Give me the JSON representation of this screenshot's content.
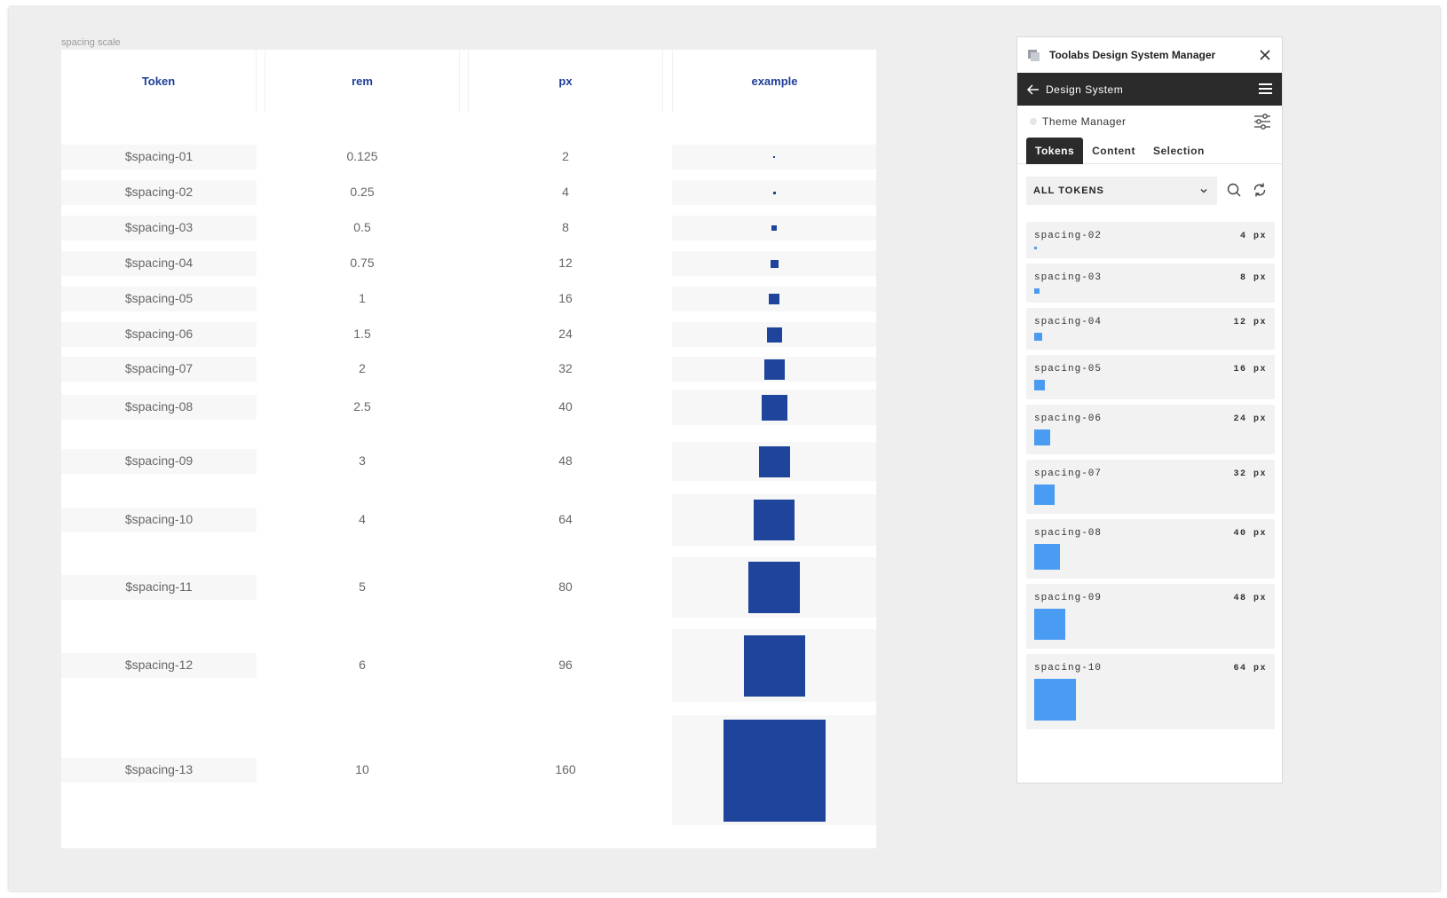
{
  "frame": {
    "label": "spacing scale"
  },
  "table": {
    "headers": [
      "Token",
      "rem",
      "px",
      "example"
    ],
    "rows": [
      {
        "token": "$spacing-01",
        "rem": "0.125",
        "px": "2"
      },
      {
        "token": "$spacing-02",
        "rem": "0.25",
        "px": "4"
      },
      {
        "token": "$spacing-03",
        "rem": "0.5",
        "px": "8"
      },
      {
        "token": "$spacing-04",
        "rem": "0.75",
        "px": "12"
      },
      {
        "token": "$spacing-05",
        "rem": "1",
        "px": "16"
      },
      {
        "token": "$spacing-06",
        "rem": "1.5",
        "px": "24"
      },
      {
        "token": "$spacing-07",
        "rem": "2",
        "px": "32"
      },
      {
        "token": "$spacing-08",
        "rem": "2.5",
        "px": "40"
      },
      {
        "token": "$spacing-09",
        "rem": "3",
        "px": "48"
      },
      {
        "token": "$spacing-10",
        "rem": "4",
        "px": "64"
      },
      {
        "token": "$spacing-11",
        "rem": "5",
        "px": "80"
      },
      {
        "token": "$spacing-12",
        "rem": "6",
        "px": "96"
      },
      {
        "token": "$spacing-13",
        "rem": "10",
        "px": "160"
      }
    ],
    "example_color": "#1e449c"
  },
  "plugin": {
    "title": "Toolabs Design System Manager",
    "nav_title": "Design System",
    "theme_label": "Theme Manager",
    "tabs": [
      "Tokens",
      "Content",
      "Selection"
    ],
    "active_tab": "Tokens",
    "filter_value": "ALL TOKENS",
    "token_color": "#4a9cf2",
    "tokens": [
      {
        "name": "spacing-02",
        "value": "4 px"
      },
      {
        "name": "spacing-03",
        "value": "8 px"
      },
      {
        "name": "spacing-04",
        "value": "12 px"
      },
      {
        "name": "spacing-05",
        "value": "16 px"
      },
      {
        "name": "spacing-06",
        "value": "24 px"
      },
      {
        "name": "spacing-07",
        "value": "32 px"
      },
      {
        "name": "spacing-08",
        "value": "40 px"
      },
      {
        "name": "spacing-09",
        "value": "48 px"
      },
      {
        "name": "spacing-10",
        "value": "64 px"
      }
    ]
  }
}
